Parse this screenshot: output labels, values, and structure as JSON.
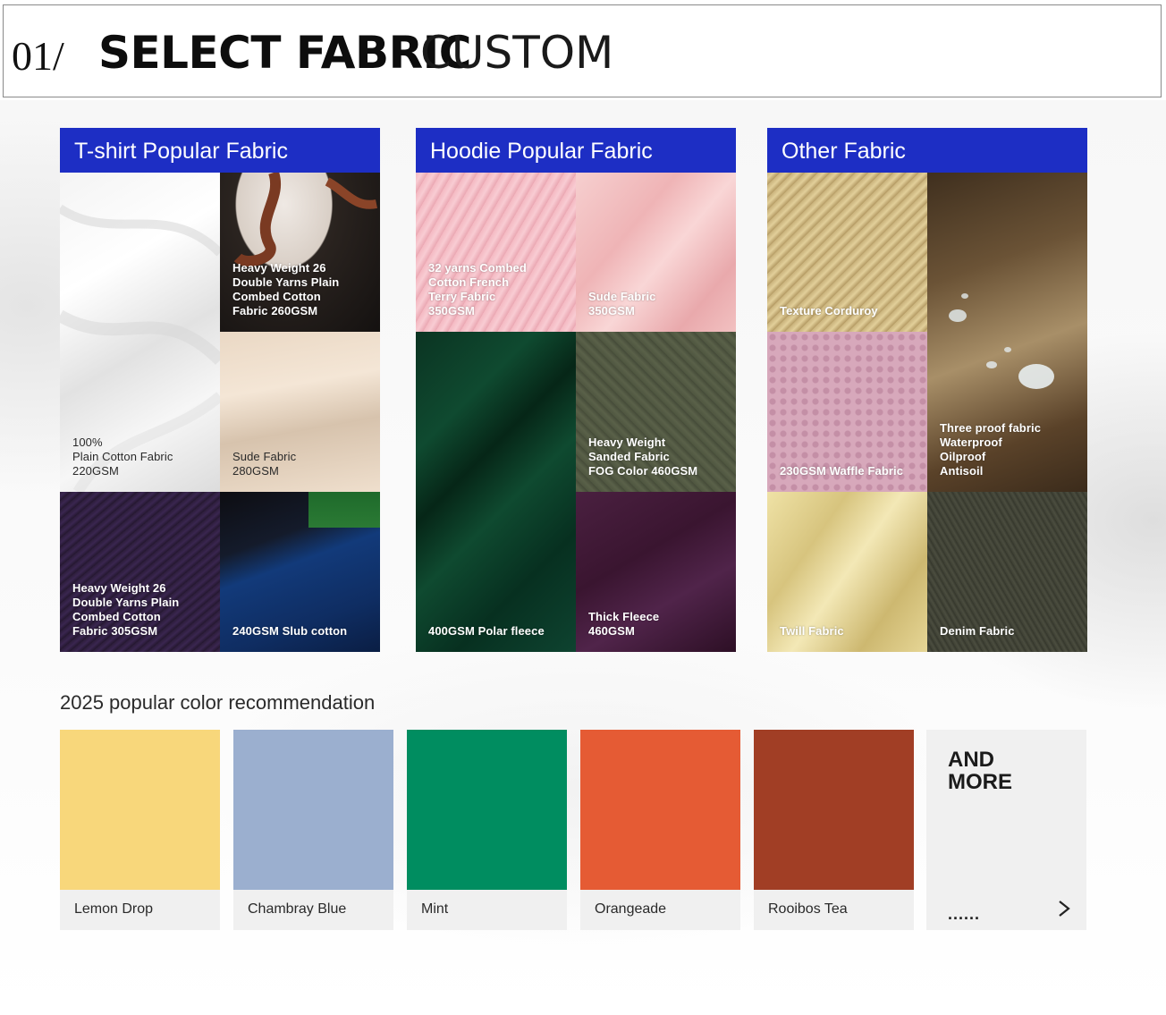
{
  "header": {
    "number": "01/",
    "title_bold": "SELECT FABRIC",
    "title_light": "CUSTOM"
  },
  "panels": [
    {
      "title": "T-shirt Popular Fabric",
      "tiles": [
        {
          "label": "100%\nPlain Cotton Fabric\n220GSM",
          "color": "#ececec"
        },
        {
          "label": "Heavy Weight 26\nDouble Yarns Plain\nCombed Cotton\nFabric 260GSM",
          "color": "#2a2420"
        },
        {
          "label": "Sude Fabric\n280GSM",
          "color": "#e9d8c4"
        },
        {
          "label": "Heavy Weight 26\nDouble Yarns Plain\nCombed Cotton\nFabric 305GSM",
          "color": "#2b1d38"
        },
        {
          "label": "240GSM Slub cotton",
          "color": "#0c1a33"
        }
      ]
    },
    {
      "title": "Hoodie Popular Fabric",
      "tiles": [
        {
          "label": "32 yarns Combed\nCotton French\nTerry Fabric\n350GSM",
          "color": "#f2b6bf"
        },
        {
          "label": "Sude Fabric\n350GSM",
          "color": "#f0bcbc"
        },
        {
          "label": "400GSM Polar fleece",
          "color": "#0d3b25"
        },
        {
          "label": "Heavy Weight\nSanded Fabric\nFOG Color 460GSM",
          "color": "#4f5640"
        },
        {
          "label": "Thick Fleece\n460GSM",
          "color": "#3e1a35"
        }
      ]
    },
    {
      "title": "Other Fabric",
      "tiles": [
        {
          "label": "Texture Corduroy",
          "color": "#c7b07a"
        },
        {
          "label": "Three proof fabric\nWaterproof\nOilproof\nAntisoil",
          "color": "#6b5336"
        },
        {
          "label": "230GSM Waffle Fabric",
          "color": "#d7a8bb"
        },
        {
          "label": "Twill Fabric",
          "color": "#e3d38f"
        },
        {
          "label": "Denim Fabric",
          "color": "#3f3f33"
        }
      ]
    }
  ],
  "colors_section": {
    "title": "2025 popular color recommendation",
    "swatches": [
      {
        "name": "Lemon Drop",
        "color": "#f8d77b"
      },
      {
        "name": "Chambray Blue",
        "color": "#9bafcf"
      },
      {
        "name": "Mint",
        "color": "#008d60"
      },
      {
        "name": "Orangeade",
        "color": "#e55b34"
      },
      {
        "name": "Rooibos Tea",
        "color": "#a13e25"
      }
    ],
    "more": {
      "line1": "AND",
      "line2": "MORE",
      "dots": "......"
    }
  }
}
